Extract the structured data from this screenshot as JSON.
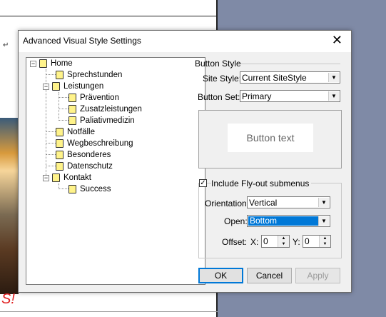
{
  "dialog": {
    "title": "Advanced Visual Style Settings",
    "close_glyph": "✕"
  },
  "tree": {
    "items": [
      {
        "label": "Home",
        "expander": "−"
      },
      {
        "label": "Sprechstunden"
      },
      {
        "label": "Leistungen",
        "expander": "−"
      },
      {
        "label": "Prävention"
      },
      {
        "label": "Zusatzleistungen"
      },
      {
        "label": "Paliativmedizin"
      },
      {
        "label": "Notfälle"
      },
      {
        "label": "Wegbeschreibung"
      },
      {
        "label": "Besonderes"
      },
      {
        "label": "Datenschutz"
      },
      {
        "label": "Kontakt",
        "expander": "−"
      },
      {
        "label": "Success"
      }
    ]
  },
  "button_style": {
    "heading": "Button Style",
    "site_style_label": "Site Style:",
    "site_style_value": "Current SiteStyle",
    "button_set_label": "Button Set:",
    "button_set_value": "Primary",
    "preview_text": "Button text"
  },
  "flyout": {
    "checkbox_label": "Include Fly-out submenus",
    "checked_glyph": "✓",
    "orientation_label": "Orientation:",
    "orientation_value": "Vertical",
    "open_label": "Open:",
    "open_value": "Bottom",
    "offset_label": "Offset:",
    "x_label": "X:",
    "x_value": "0",
    "y_label": "Y:",
    "y_value": "0"
  },
  "buttons": {
    "ok": "OK",
    "cancel": "Cancel",
    "apply": "Apply"
  },
  "background": {
    "partial_text": "S!"
  },
  "colors": {
    "selection": "#0078d7",
    "folder": "#fff38a",
    "desktop": "#7f8aa6"
  }
}
